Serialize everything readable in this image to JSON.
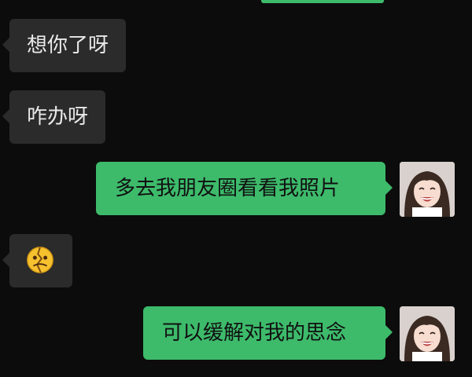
{
  "messages": [
    {
      "side": "in",
      "text": "想你了呀"
    },
    {
      "side": "in",
      "text": "咋办呀"
    },
    {
      "side": "out",
      "text": "多去我朋友圈看看我照片"
    },
    {
      "side": "in",
      "emoji": "broken-face-emoji"
    },
    {
      "side": "out",
      "text": "可以缓解对我的思念"
    }
  ],
  "colors": {
    "background": "#0c0c0c",
    "incoming_bubble": "#2b2b2b",
    "outgoing_bubble": "#3dbb6b"
  }
}
